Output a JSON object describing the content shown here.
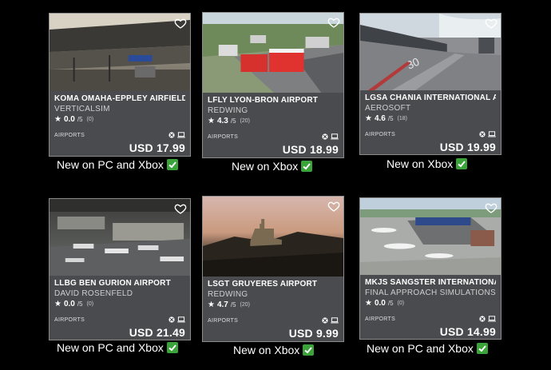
{
  "cards": [
    {
      "title": "KOMA OMAHA-EPPLEY AIRFIELD",
      "developer": "VERTICALSIM",
      "rating": "0.0",
      "out_of": "/5",
      "count": "(0)",
      "category": "AIRPORTS",
      "price": "USD 17.99",
      "caption": "New on PC and Xbox"
    },
    {
      "title": "LFLY LYON-BRON AIRPORT",
      "developer": "REDWING",
      "rating": "4.3",
      "out_of": "/5",
      "count": "(20)",
      "category": "AIRPORTS",
      "price": "USD 18.99",
      "caption": "New on Xbox"
    },
    {
      "title": "LGSA CHANIA INTERNATIONAL AII",
      "developer": "AEROSOFT",
      "rating": "4.6",
      "out_of": "/5",
      "count": "(18)",
      "category": "AIRPORTS",
      "price": "USD 19.99",
      "caption": "New on Xbox"
    },
    {
      "title": "LLBG BEN GURION AIRPORT",
      "developer": "DAVID ROSENFELD",
      "rating": "0.0",
      "out_of": "/5",
      "count": "(0)",
      "category": "AIRPORTS",
      "price": "USD 21.49",
      "caption": "New on PC and Xbox"
    },
    {
      "title": "LSGT GRUYERES AIRPORT",
      "developer": "REDWING",
      "rating": "4.7",
      "out_of": "/5",
      "count": "(20)",
      "category": "AIRPORTS",
      "price": "USD 9.99",
      "caption": "New on Xbox"
    },
    {
      "title": "MKJS SANGSTER INTERNATIONAL",
      "developer": "FINAL APPROACH SIMULATIONS",
      "rating": "0.0",
      "out_of": "/5",
      "count": "(0)",
      "category": "AIRPORTS",
      "price": "USD 14.99",
      "caption": "New on PC and Xbox"
    }
  ],
  "icons": {
    "favorite": "heart-icon",
    "rating": "star-icon",
    "platform_1": "xbox-icon",
    "platform_2": "pc-icon",
    "caption": "checkmark-icon"
  },
  "colors": {
    "card_background": "#4a4b4f",
    "check_green": "#3aa33a"
  }
}
